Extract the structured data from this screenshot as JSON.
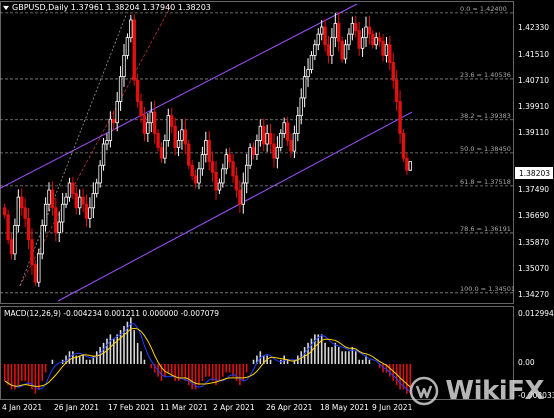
{
  "header": {
    "symbol_line": "GBPUSD,Daily  1.37961 1.38204 1.37940 1.38203"
  },
  "colors": {
    "background": "#000000",
    "bull_candle": "#ffffff",
    "bear_candle": "#e01010",
    "channel": "#a050ff",
    "fib": "#8a8a8a",
    "macd_signal": "#ffd400",
    "macd_blue": "#2040ff",
    "price_box_bg": "#ffffff",
    "price_box_fg": "#000000"
  },
  "price_axis": {
    "labels": [
      "1.42330",
      "1.41510",
      "1.40710",
      "1.39910",
      "1.39110",
      "1.38203",
      "1.37490",
      "1.36690",
      "1.35870",
      "1.35070",
      "1.34270"
    ],
    "current": "1.38203"
  },
  "fib_levels": [
    {
      "label": "0.0 = 1.42400"
    },
    {
      "label": "23.6 = 1.40536"
    },
    {
      "label": "38.2 = 1.39383"
    },
    {
      "label": "50.0 = 1.38450"
    },
    {
      "label": "61.8 = 1.37518"
    },
    {
      "label": "78.6 = 1.36191"
    },
    {
      "label": "100.0 = 1.34501"
    }
  ],
  "macd": {
    "label": "MACD(12,26,9) -0.004234 0.001211 0.000000 -0.007079",
    "axis_top": "0.012994",
    "axis_zero": "0.00",
    "axis_bottom": "-0.008033"
  },
  "date_axis": {
    "labels": [
      "4 Jan 2021",
      "26 Jan 2021",
      "17 Feb 2021",
      "11 Mar 2021",
      "2 Apr 2021",
      "26 Apr 2021",
      "18 May 2021",
      "9 Jun 2021"
    ]
  },
  "watermark": {
    "text": "WikiFX"
  },
  "chart_data": {
    "type": "candlestick",
    "title": "GBPUSD,Daily",
    "ohlc_last": {
      "open": 1.37961,
      "high": 1.38204,
      "low": 1.3794,
      "close": 1.38203
    },
    "ylim": [
      1.3427,
      1.4265
    ],
    "fib_retracement": [
      {
        "ratio": 0.0,
        "price": 1.424
      },
      {
        "ratio": 23.6,
        "price": 1.40536
      },
      {
        "ratio": 38.2,
        "price": 1.39383
      },
      {
        "ratio": 50.0,
        "price": 1.3845
      },
      {
        "ratio": 61.8,
        "price": 1.37518
      },
      {
        "ratio": 78.6,
        "price": 1.36191
      },
      {
        "ratio": 100.0,
        "price": 1.34501
      }
    ],
    "closes": [
      1.367,
      1.36,
      1.356,
      1.364,
      1.372,
      1.369,
      1.366,
      1.36,
      1.353,
      1.348,
      1.356,
      1.364,
      1.37,
      1.374,
      1.369,
      1.362,
      1.365,
      1.37,
      1.372,
      1.376,
      1.373,
      1.369,
      1.372,
      1.37,
      1.366,
      1.369,
      1.373,
      1.376,
      1.381,
      1.387,
      1.388,
      1.394,
      1.393,
      1.399,
      1.406,
      1.412,
      1.417,
      1.422,
      1.405,
      1.399,
      1.395,
      1.39,
      1.393,
      1.396,
      1.39,
      1.386,
      1.383,
      1.388,
      1.395,
      1.392,
      1.386,
      1.388,
      1.391,
      1.387,
      1.381,
      1.378,
      1.376,
      1.38,
      1.384,
      1.388,
      1.382,
      1.379,
      1.374,
      1.376,
      1.38,
      1.384,
      1.382,
      1.378,
      1.374,
      1.37,
      1.376,
      1.381,
      1.386,
      1.384,
      1.388,
      1.392,
      1.387,
      1.39,
      1.387,
      1.383,
      1.386,
      1.39,
      1.393,
      1.388,
      1.385,
      1.39,
      1.395,
      1.4,
      1.406,
      1.408,
      1.412,
      1.415,
      1.418,
      1.42,
      1.415,
      1.412,
      1.417,
      1.421,
      1.416,
      1.411,
      1.415,
      1.418,
      1.421,
      1.419,
      1.414,
      1.417,
      1.42,
      1.418,
      1.415,
      1.417,
      1.416,
      1.412,
      1.415,
      1.41,
      1.405,
      1.399,
      1.39,
      1.383,
      1.3796,
      1.38203
    ],
    "macd_hist": [
      -0.004,
      -0.005,
      -0.006,
      -0.006,
      -0.005,
      -0.004,
      -0.004,
      -0.005,
      -0.006,
      -0.007,
      -0.006,
      -0.004,
      -0.002,
      0.0,
      0.001,
      0.0,
      0.0,
      0.001,
      0.002,
      0.003,
      0.003,
      0.002,
      0.002,
      0.002,
      0.001,
      0.001,
      0.002,
      0.003,
      0.004,
      0.005,
      0.006,
      0.007,
      0.006,
      0.007,
      0.008,
      0.009,
      0.01,
      0.011,
      0.008,
      0.005,
      0.003,
      0.001,
      0.0,
      -0.001,
      -0.002,
      -0.003,
      -0.004,
      -0.003,
      -0.002,
      -0.003,
      -0.004,
      -0.004,
      -0.003,
      -0.004,
      -0.005,
      -0.006,
      -0.006,
      -0.005,
      -0.004,
      -0.003,
      -0.003,
      -0.004,
      -0.005,
      -0.004,
      -0.003,
      -0.002,
      -0.002,
      -0.003,
      -0.004,
      -0.005,
      -0.004,
      -0.002,
      0.0,
      0.001,
      0.002,
      0.003,
      0.002,
      0.002,
      0.001,
      0.0,
      0.0,
      0.001,
      0.002,
      0.001,
      0.0,
      0.001,
      0.002,
      0.003,
      0.004,
      0.005,
      0.006,
      0.007,
      0.007,
      0.007,
      0.005,
      0.004,
      0.004,
      0.005,
      0.004,
      0.003,
      0.003,
      0.003,
      0.004,
      0.003,
      0.001,
      0.001,
      0.002,
      0.001,
      0.0,
      0.0,
      -0.001,
      -0.002,
      -0.002,
      -0.003,
      -0.004,
      -0.005,
      -0.006,
      -0.006,
      -0.007,
      -0.007
    ]
  }
}
